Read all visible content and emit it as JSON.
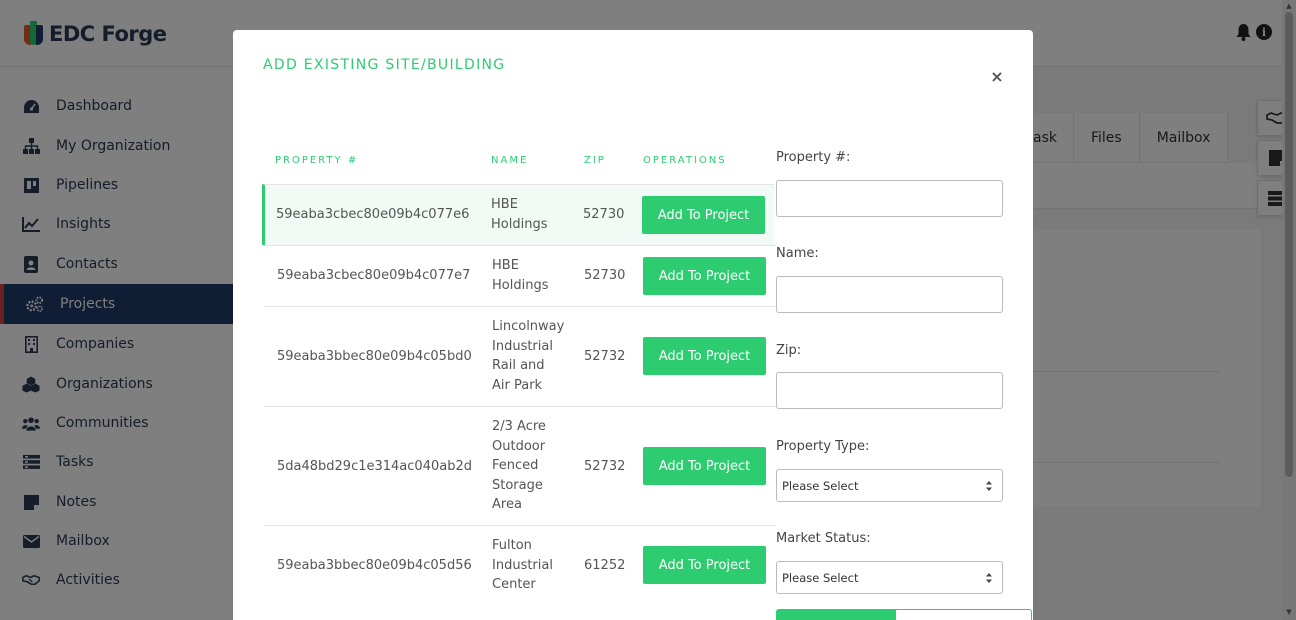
{
  "app": {
    "logo_text": "EDC Forge"
  },
  "sidebar": {
    "items": [
      {
        "label": "Dashboard",
        "icon": "dashboard-icon"
      },
      {
        "label": "My Organization",
        "icon": "sitemap-icon"
      },
      {
        "label": "Pipelines",
        "icon": "pipeline-icon"
      },
      {
        "label": "Insights",
        "icon": "line-chart-icon"
      },
      {
        "label": "Contacts",
        "icon": "contact-card-icon"
      },
      {
        "label": "Projects",
        "icon": "gears-icon",
        "active": true
      },
      {
        "label": "Companies",
        "icon": "building-icon"
      },
      {
        "label": "Organizations",
        "icon": "cubes-icon"
      },
      {
        "label": "Communities",
        "icon": "users-icon"
      },
      {
        "label": "Tasks",
        "icon": "tasks-icon"
      },
      {
        "label": "Notes",
        "icon": "note-icon"
      },
      {
        "label": "Mailbox",
        "icon": "envelope-icon"
      },
      {
        "label": "Activities",
        "icon": "handshake-icon"
      }
    ]
  },
  "background_tabs": [
    "ask",
    "Files",
    "Mailbox"
  ],
  "modal": {
    "title": "ADD EXISTING SITE/BUILDING",
    "close_label": "×",
    "columns": [
      "PROPERTY #",
      "NAME",
      "ZIP",
      "OPERATIONS"
    ],
    "rows": [
      {
        "property": "59eaba3cbec80e09b4c077e6",
        "name": [
          "HBE",
          "Holdings"
        ],
        "zip": "52730",
        "action": "Add To Project"
      },
      {
        "property": "59eaba3cbec80e09b4c077e7",
        "name": [
          "HBE",
          "Holdings"
        ],
        "zip": "52730",
        "action": "Add To Project"
      },
      {
        "property": "59eaba3bbec80e09b4c05bd0",
        "name": [
          "Lincolnway",
          "Industrial",
          "Rail and",
          "Air Park"
        ],
        "zip": "52732",
        "action": "Add To Project"
      },
      {
        "property": "5da48bd29c1e314ac040ab2d",
        "name": [
          "2/3 Acre",
          "Outdoor",
          "Fenced",
          "Storage",
          "Area"
        ],
        "zip": "52732",
        "action": "Add To Project"
      },
      {
        "property": "59eaba3bbec80e09b4c05d56",
        "name": [
          "Fulton",
          "Industrial",
          "Center"
        ],
        "zip": "61252",
        "action": "Add To Project"
      }
    ],
    "filters": {
      "property_label": "Property #:",
      "property_value": "",
      "name_label": "Name:",
      "name_value": "",
      "zip_label": "Zip:",
      "zip_value": "",
      "property_type_label": "Property Type:",
      "property_type_value": "Please Select",
      "market_status_label": "Market Status:",
      "market_status_value": "Please Select"
    }
  },
  "colors": {
    "accent": "#2ecc71",
    "nav_active": "#1f3a6b",
    "nav_active_border": "#d94040",
    "brand_text": "#2b3a55"
  }
}
